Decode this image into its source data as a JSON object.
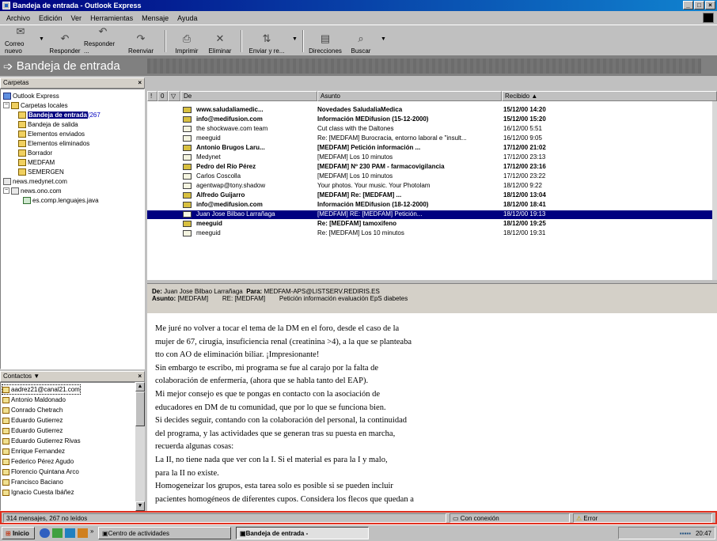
{
  "window": {
    "title": "Bandeja de entrada - Outlook Express"
  },
  "menu": [
    "Archivo",
    "Edición",
    "Ver",
    "Herramientas",
    "Mensaje",
    "Ayuda"
  ],
  "toolbar": [
    {
      "label": "Correo nuevo",
      "icon": "new-mail-icon"
    },
    {
      "label": "Responder",
      "icon": "reply-icon"
    },
    {
      "label": "Responder ...",
      "icon": "reply-all-icon"
    },
    {
      "label": "Reenviar",
      "icon": "forward-icon"
    },
    {
      "label": "Imprimir",
      "icon": "print-icon"
    },
    {
      "label": "Eliminar",
      "icon": "delete-icon"
    },
    {
      "label": "Enviar y re...",
      "icon": "send-receive-icon"
    },
    {
      "label": "Direcciones",
      "icon": "address-book-icon"
    },
    {
      "label": "Buscar",
      "icon": "find-icon"
    }
  ],
  "banner": {
    "title": "Bandeja de entrada"
  },
  "folders": {
    "header": "Carpetas",
    "items": [
      {
        "label": "Outlook Express",
        "unread": ""
      },
      {
        "label": "Carpetas locales",
        "unread": ""
      },
      {
        "label": "Bandeja de entrada",
        "unread": "(267"
      },
      {
        "label": "Bandeja de salida",
        "unread": ""
      },
      {
        "label": "Elementos enviados",
        "unread": ""
      },
      {
        "label": "Elementos eliminados",
        "unread": ""
      },
      {
        "label": "Borrador",
        "unread": ""
      },
      {
        "label": "MEDFAM",
        "unread": ""
      },
      {
        "label": "SEMERGEN",
        "unread": ""
      },
      {
        "label": "news.medynet.com",
        "unread": ""
      },
      {
        "label": "news.ono.com",
        "unread": ""
      },
      {
        "label": "es.comp.lenguajes.java",
        "unread": ""
      }
    ]
  },
  "contacts": {
    "header": "Contactos ▼",
    "items": [
      "aadrez21@canal21.com",
      "Antonio Maldonado",
      "Conrado Chetrach",
      "Eduardo Gutierrez",
      "Eduardo Gutierrez",
      "Eduardo Gutierrez Rivas",
      "Enrique Fernandez",
      "Federico Pérez Agudo",
      "Florencio Quintana Arco",
      "Francisco Baciano",
      "Ignacio Cuesta Ibáñez"
    ]
  },
  "list": {
    "columns": [
      "!",
      "0",
      "▽",
      "De",
      "Asunto",
      "Recibido ▲"
    ],
    "rows": [
      {
        "from": "www.saludaliamedic...",
        "subject": "Novedades SaludaliaMedica",
        "date": "15/12/00 14:20",
        "unread": true
      },
      {
        "from": "info@medifusion.com",
        "subject": "Información MEDifusion (15-12-2000)",
        "date": "15/12/00 15:20",
        "unread": true
      },
      {
        "from": "the shockwave.com team",
        "subject": "Cut class with the Daltones",
        "date": "16/12/00 5:51",
        "unread": false
      },
      {
        "from": "meeguid",
        "subject": "Re: [MEDFAM] Burocracia, entorno laboral e \"insult...",
        "date": "16/12/00 9:05",
        "unread": false
      },
      {
        "from": "Antonio Brugos Laru...",
        "subject": "[MEDFAM]        Petición información ...",
        "date": "17/12/00 21:02",
        "unread": true
      },
      {
        "from": "Medynet",
        "subject": "[MEDFAM] Los 10 minutos",
        "date": "17/12/00 23:13",
        "unread": false
      },
      {
        "from": "Pedro del Río Pérez",
        "subject": "[MEDFAM] Nº 230 PAM - farmacovigilancia",
        "date": "17/12/00 23:16",
        "unread": true
      },
      {
        "from": "Carlos Coscolla",
        "subject": "[MEDFAM] Los 10 minutos",
        "date": "17/12/00 23:22",
        "unread": false
      },
      {
        "from": "agentwap@tony.shadow",
        "subject": "Your photos. Your music. Your Photolam",
        "date": "18/12/00 9:22",
        "unread": false
      },
      {
        "from": "Alfredo Guijarro",
        "subject": "[MEDFAM]        Re: [MEDFAM]        ...",
        "date": "18/12/00 13:04",
        "unread": true
      },
      {
        "from": "info@medifusion.com",
        "subject": "Información MEDifusion (18-12-2000)",
        "date": "18/12/00 18:41",
        "unread": true
      },
      {
        "from": "Juan Jose Bilbao Larrañaga",
        "subject": "[MEDFAM]        RE: [MEDFAM]        Petición...",
        "date": "18/12/00 19:13",
        "unread": false,
        "selected": true
      },
      {
        "from": "meeguid",
        "subject": "Re: [MEDFAM] tamoxifeno",
        "date": "18/12/00 19:25",
        "unread": true
      },
      {
        "from": "meeguid",
        "subject": "Re: [MEDFAM] Los 10 minutos",
        "date": "18/12/00 19:31",
        "unread": false
      }
    ]
  },
  "preview_header": {
    "from_label": "De:",
    "from": "Juan Jose Bilbao Larrañaga",
    "to_label": "Para:",
    "to": "MEDFAM-APS@LISTSERV.REDIRIS.ES",
    "subject_label": "Asunto:",
    "subject": "[MEDFAM]        RE: [MEDFAM]        Petición información evaluación EpS diabetes"
  },
  "preview_body": [
    "Me juré no volver a tocar el tema de la DM en el foro, desde el caso de la",
    "mujer de 67, cirugía, insuficiencia renal (creatinina >4), a la que se planteaba",
    "tto con AO de eliminación biliar. ¡Impresionante!",
    "Sin embargo te escribo, mi programa se fue al carajo por la falta de",
    "colaboración de enfermería, (ahora que se habla tanto del EAP).",
    "Mi mejor consejo es que te pongas en contacto con la asociación de",
    "educadores en DM de tu comunidad, que por lo que se funciona bien.",
    "Si decides seguir, contando con la colaboración del personal, la continuidad",
    "del programa, y las actividades que se generan tras su puesta en marcha,",
    "recuerda algunas cosas:",
    "La II, no tiene nada que ver con la I. Si el material es para la I y malo,",
    "para la II no existe.",
    "Homogeneizar los grupos, esta tarea solo es posible si se pueden incluir",
    "pacientes homogéneos de diferentes cupos. Considera los flecos que quedan a"
  ],
  "status": {
    "count": "314 mensajes, 267 no leídos",
    "connection": "Con conexión",
    "error": "Error"
  },
  "taskbar": {
    "start": "Inicio",
    "tasks": [
      "Centro de actividades",
      "Bandeja de entrada -"
    ],
    "clock": "20:47"
  }
}
